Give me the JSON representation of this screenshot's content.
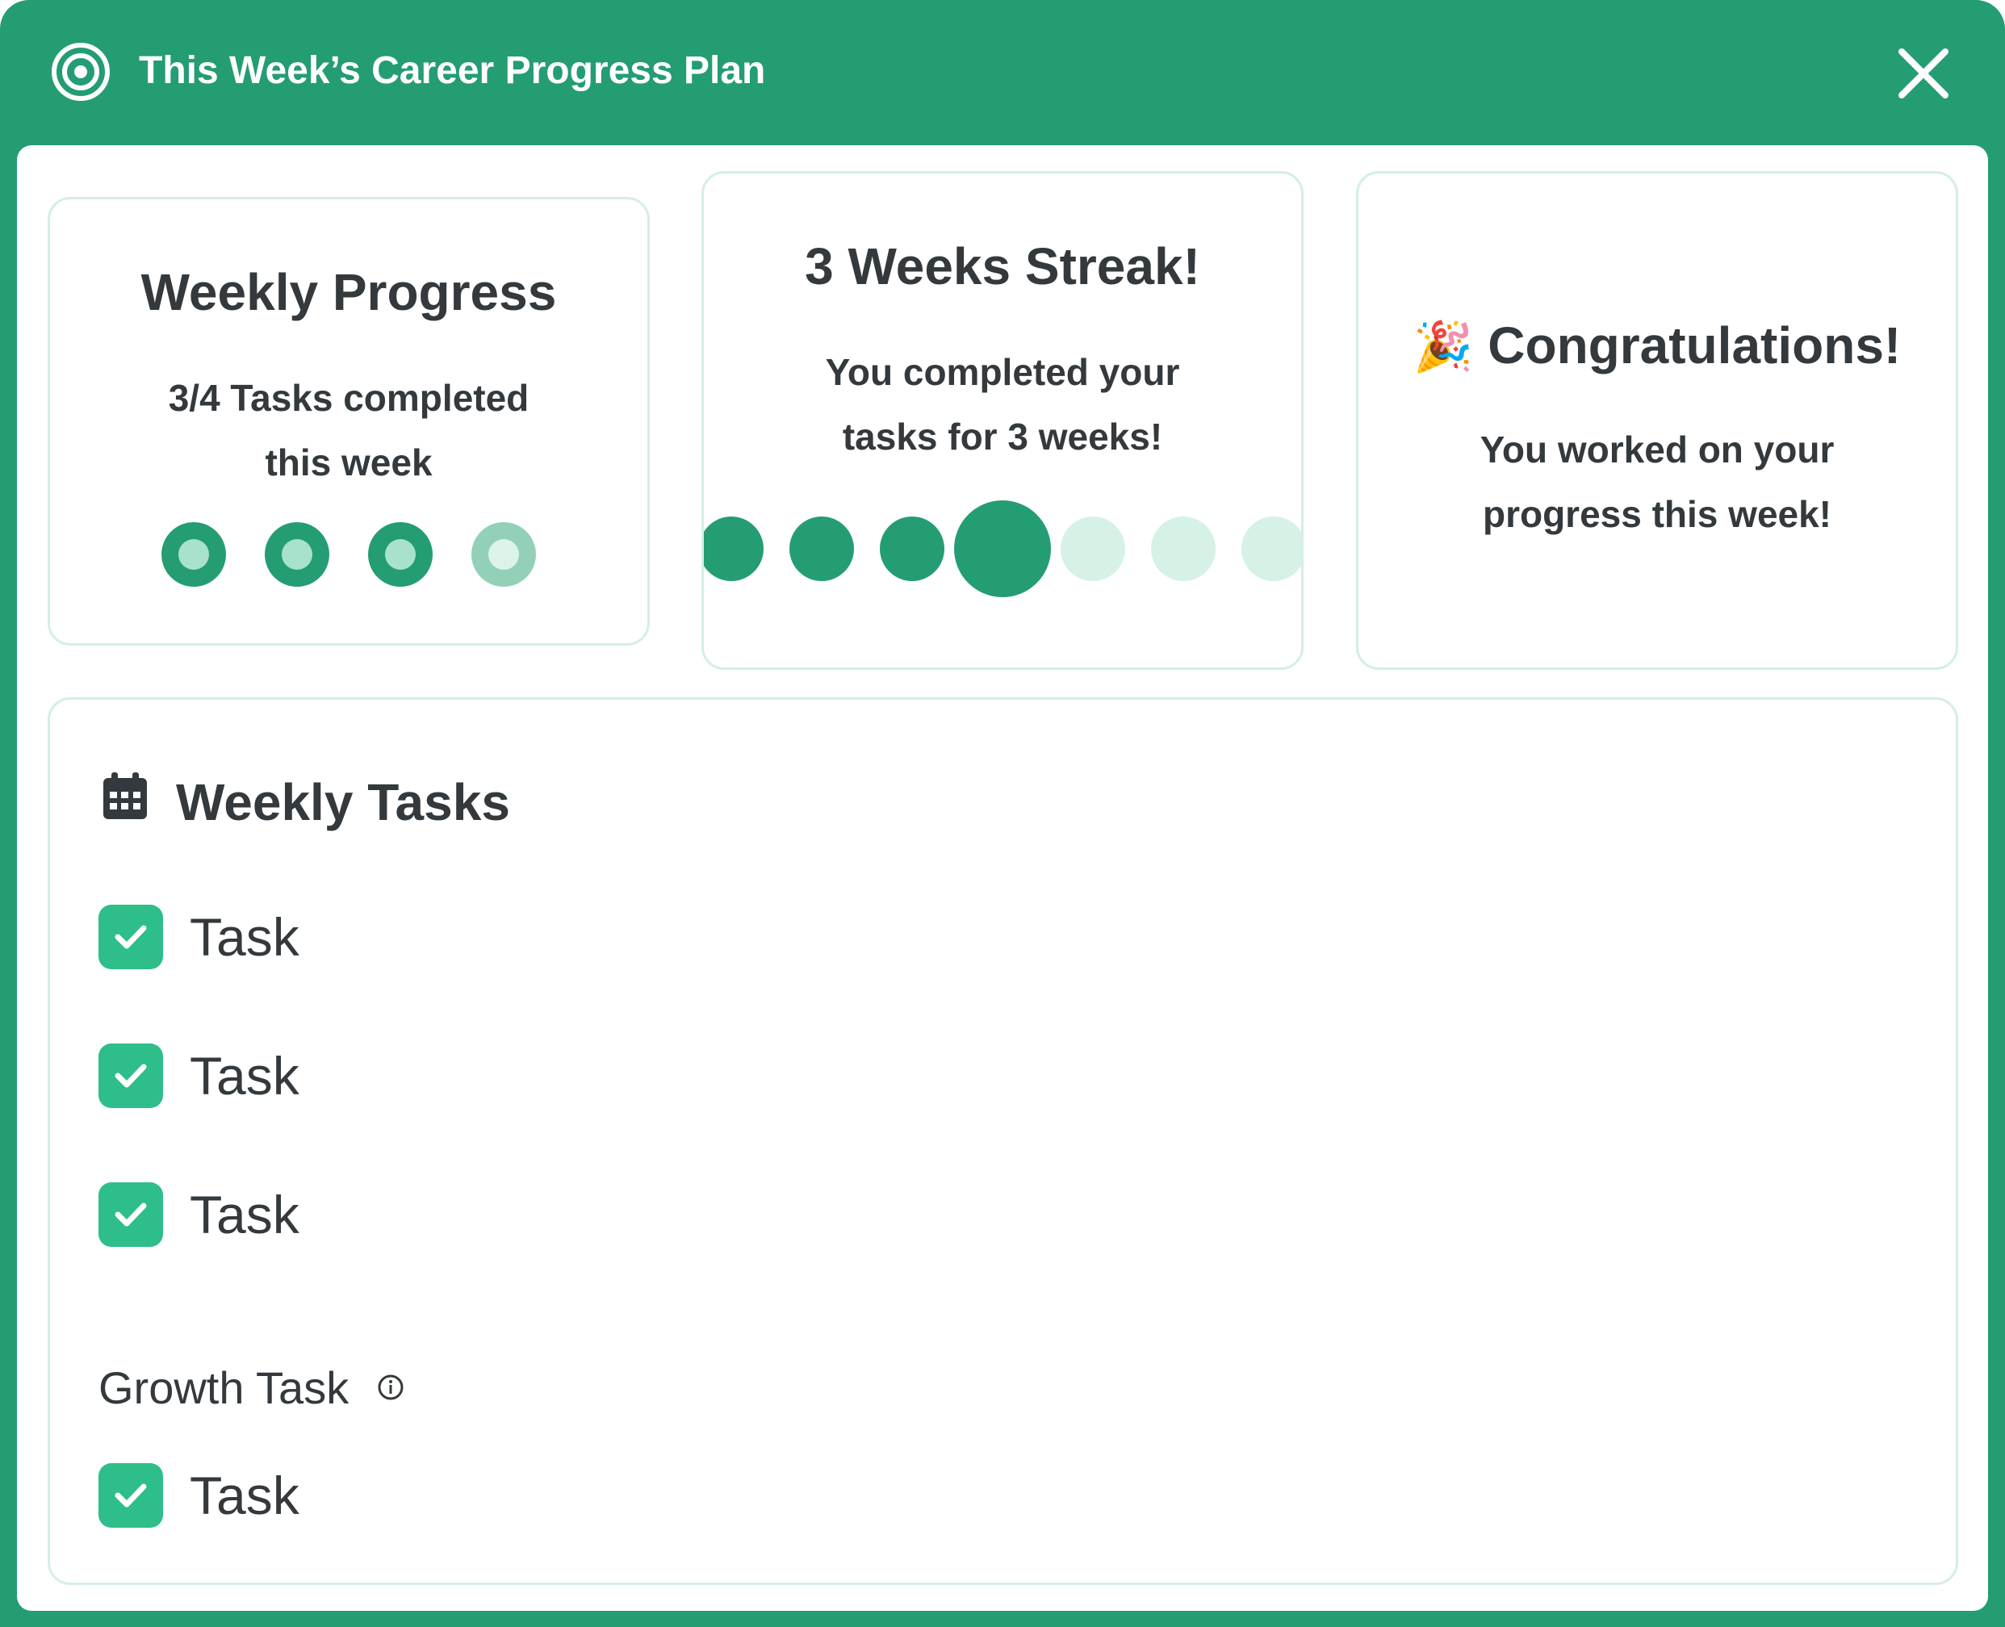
{
  "window": {
    "title": "This Week’s Career Progress Plan",
    "title_icon": "target-icon",
    "close_icon": "close-icon",
    "accent_color": "#249d72"
  },
  "weekly_progress": {
    "title": "Weekly Progress",
    "line1": "3/4 Tasks completed",
    "line2": "this week",
    "completed": 3,
    "total": 4
  },
  "streak": {
    "title": "3 Weeks Streak!",
    "line1": "You completed your",
    "line2": "tasks for 3 weeks!",
    "weeks": 3
  },
  "congrats": {
    "emoji": "🎉",
    "title": "Congratulations!",
    "line1": "You worked on your",
    "line2": "progress this week!"
  },
  "weekly_tasks": {
    "title": "Weekly Tasks",
    "icon": "calendar-icon",
    "tasks": [
      {
        "label": "Task",
        "checked": true
      },
      {
        "label": "Task",
        "checked": true
      },
      {
        "label": "Task",
        "checked": true
      }
    ],
    "growth_label": "Growth Task",
    "growth_info_icon": "info-icon",
    "growth_tasks": [
      {
        "label": "Task",
        "checked": true
      }
    ]
  }
}
